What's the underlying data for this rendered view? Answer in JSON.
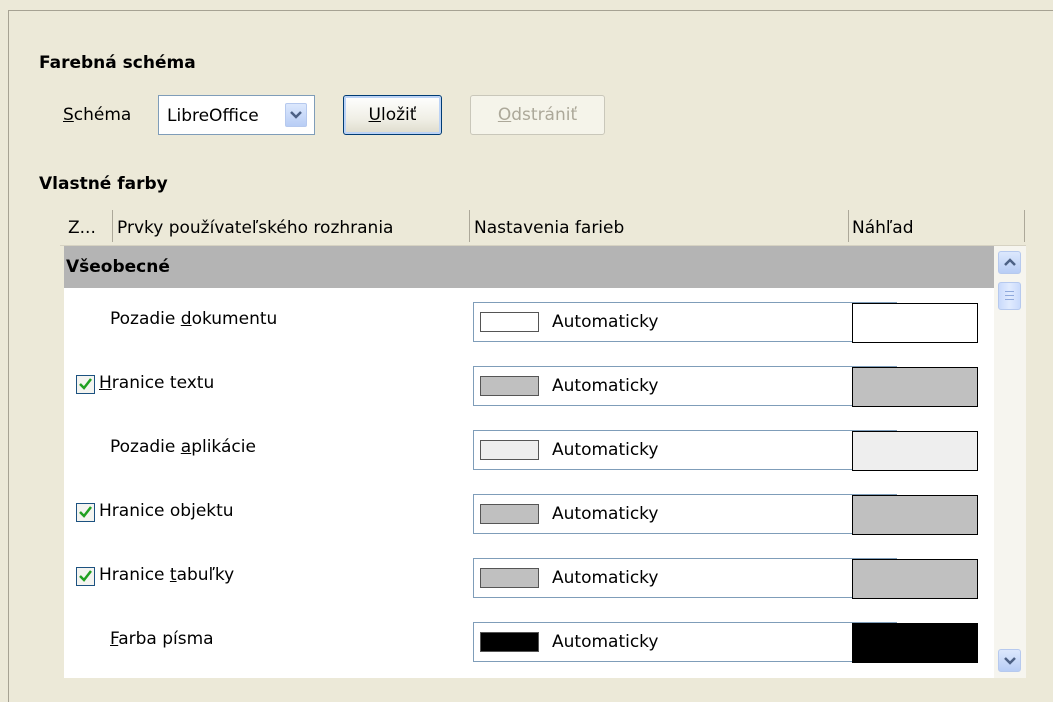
{
  "scheme_section": {
    "title": "Farebná schéma",
    "label_prefix": "S",
    "label_rest": "chéma",
    "selected": "LibreOffice",
    "save_u": "U",
    "save_rest": "ložiť",
    "delete_u": "O",
    "delete_rest": "dstrániť"
  },
  "custom_section": {
    "title": "Vlastné farby"
  },
  "columns": {
    "on": "Z...",
    "ui_elements": "Prvky používateľského rozhrania",
    "color_setting": "Nastavenia farieb",
    "preview": "Náhľad"
  },
  "group": {
    "name": "Všeobecné"
  },
  "rows": [
    {
      "pre": "Pozadie ",
      "u": "d",
      "post": "okumentu",
      "checkbox": false,
      "color": "Automaticky",
      "swatch": "#ffffff",
      "preview": "#ffffff"
    },
    {
      "pre": "",
      "u": "H",
      "post": "ranice textu",
      "checkbox": true,
      "color": "Automaticky",
      "swatch": "#c0c0c0",
      "preview": "#c0c0c0"
    },
    {
      "pre": "Pozadie ",
      "u": "a",
      "post": "plikácie",
      "checkbox": false,
      "color": "Automaticky",
      "swatch": "#eeeeee",
      "preview": "#eeeeee"
    },
    {
      "pre": "Hranice ob",
      "u": "j",
      "post": "ektu",
      "checkbox": true,
      "color": "Automaticky",
      "swatch": "#c0c0c0",
      "preview": "#c0c0c0"
    },
    {
      "pre": "Hranice ",
      "u": "t",
      "post": "abuľky",
      "checkbox": true,
      "color": "Automaticky",
      "swatch": "#c0c0c0",
      "preview": "#c0c0c0"
    },
    {
      "pre": "",
      "u": "F",
      "post": "arba písma",
      "checkbox": false,
      "color": "Automaticky",
      "swatch": "#000000",
      "preview": "#000000"
    }
  ]
}
